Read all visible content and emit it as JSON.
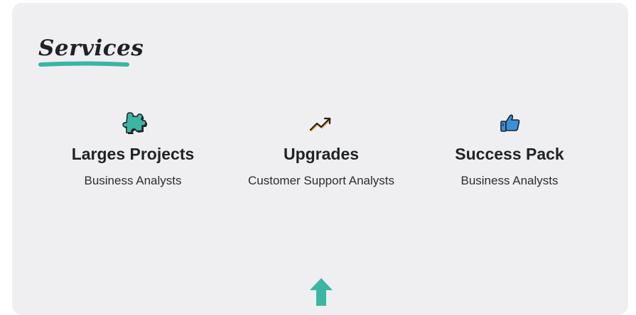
{
  "section": {
    "title": "Services"
  },
  "services": [
    {
      "icon": "puzzle-icon",
      "title": "Larges Projects",
      "description": "Business Analysts"
    },
    {
      "icon": "trending-up-icon",
      "title": "Upgrades",
      "description": "Customer Support Analysts"
    },
    {
      "icon": "thumbs-up-icon",
      "title": "Success Pack",
      "description": "Business Analysts"
    }
  ],
  "colors": {
    "card_background": "#efeff1",
    "accent_teal": "#3cb5a3",
    "accent_yellow": "#f2b233",
    "accent_blue": "#3a8fd9",
    "text_dark": "#1f2226"
  },
  "scroll_top": {
    "icon": "arrow-up-icon"
  }
}
